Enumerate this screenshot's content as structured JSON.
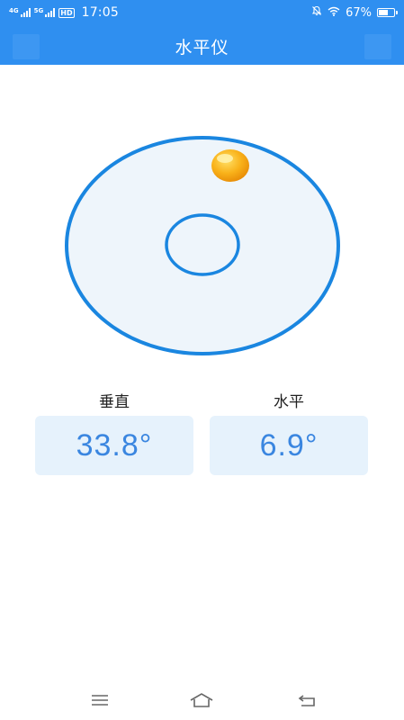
{
  "status_bar": {
    "network_1": "4G",
    "network_2": "5G",
    "hd_badge": "HD",
    "time": "17:05",
    "battery_text": "67%",
    "battery_level": 0.67
  },
  "app_bar": {
    "title": "水平仪"
  },
  "level": {
    "bubble_color": "#f6a30c",
    "ring_color": "#1a86e0",
    "fill_color": "#eef5fb"
  },
  "readouts": [
    {
      "label": "垂直",
      "value": "33.8°"
    },
    {
      "label": "水平",
      "value": "6.9°"
    }
  ],
  "nav_bar": {
    "icons": [
      "menu-icon",
      "home-icon",
      "back-icon"
    ]
  }
}
